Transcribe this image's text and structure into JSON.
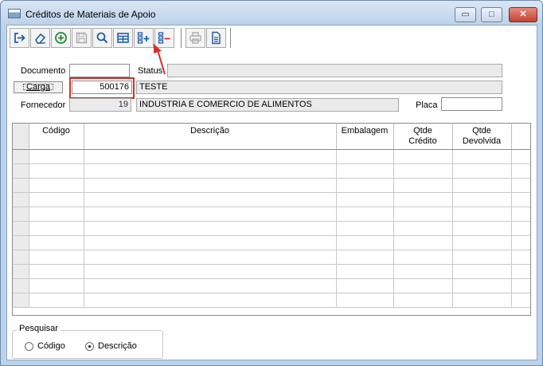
{
  "window": {
    "title": "Créditos de Materiais de Apoio",
    "min_glyph": "▭",
    "max_glyph": "□",
    "close_glyph": "✕"
  },
  "toolbar": {
    "buttons": [
      {
        "name": "exit-icon"
      },
      {
        "name": "eraser-icon"
      },
      {
        "name": "add-circle-icon"
      },
      {
        "name": "save-icon"
      },
      {
        "name": "search-icon"
      },
      {
        "name": "grid-icon"
      },
      {
        "name": "add-row-icon"
      },
      {
        "name": "remove-row-icon"
      },
      {
        "name": "print-icon"
      },
      {
        "name": "document-icon"
      }
    ]
  },
  "form": {
    "documento_label": "Documento",
    "documento_value": "",
    "status_label": "Status",
    "status_value": "",
    "carga_label": "Carga",
    "carga_value": "500176",
    "carga_desc": "TESTE",
    "fornecedor_label": "Fornecedor",
    "fornecedor_code": "19",
    "fornecedor_name": "INDUSTRIA E COMERCIO DE ALIMENTOS",
    "placa_label": "Placa",
    "placa_value": ""
  },
  "grid": {
    "columns": [
      {
        "line1": "Código",
        "line2": ""
      },
      {
        "line1": "Descrição",
        "line2": ""
      },
      {
        "line1": "Embalagem",
        "line2": ""
      },
      {
        "line1": "Qtde",
        "line2": "Crédito"
      },
      {
        "line1": "Qtde",
        "line2": "Devolvida"
      }
    ],
    "row_count": 11
  },
  "search": {
    "title": "Pesquisar",
    "options": [
      "Código",
      "Descrição"
    ],
    "selected": "Descrição"
  },
  "colors": {
    "highlight": "#d2302a",
    "accent": "#2a6fb4"
  }
}
